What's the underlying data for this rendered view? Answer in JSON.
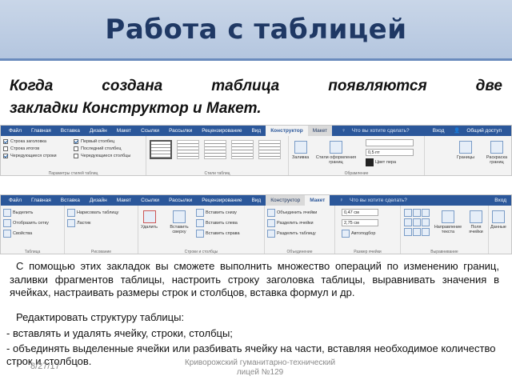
{
  "slide": {
    "title": "Работа с таблицей",
    "subtitle_line1": "Когда создана таблица появляются две",
    "subtitle_line2": "закладки Конструктор и Макет.",
    "paragraph": "С помощью этих закладок вы сможете выполнить множество операций по изменению границ, заливки фрагментов таблицы, настроить строку заголовка таблицы, выравнивать значения в ячейках, настраивать размеры строк и столбцов, вставка формул и др.",
    "edit_heading": "Редактировать структуру таблицы:",
    "bullets": [
      "вставлять и удалять ячейку, строки, столбцы;",
      "объединять выделенные ячейки или разбивать ячейку на части, вставляя необходимое количество строк и столбцов."
    ],
    "date": "8/27/17",
    "school": "Криворожский гуманитарно-технический лицей №129"
  },
  "ribbon1": {
    "tabs": [
      "Файл",
      "Главная",
      "Вставка",
      "Дизайн",
      "Макет",
      "Ссылки",
      "Рассылки",
      "Рецензирование",
      "Вид"
    ],
    "ctx_tab_active": "Конструктор",
    "ctx_tab": "Макет",
    "tell_me": "Что вы хотите сделать?",
    "login": "Вход",
    "share": "Общий доступ",
    "style_options": [
      "Строка заголовка",
      "Строка итогов",
      "Чередующиеся строки",
      "Первый столбец",
      "Последний столбец",
      "Чередующиеся столбцы"
    ],
    "group_style_options": "Параметры стилей таблиц",
    "group_styles": "Стили таблиц",
    "fill_label": "Заливка",
    "border_styles_label": "Стили оформления границ",
    "pen_weight": "0,5 пт",
    "pen_color": "Цвет пера",
    "borders_label": "Границы",
    "painter_label": "Раскраска границ",
    "group_borders": "Обрамление"
  },
  "ribbon2": {
    "tabs": [
      "Файл",
      "Главная",
      "Вставка",
      "Дизайн",
      "Макет",
      "Ссылки",
      "Рассылки",
      "Рецензирование",
      "Вид"
    ],
    "ctx_tab": "Конструктор",
    "ctx_tab_active": "Макет",
    "tell_me": "Что вы хотите сделать?",
    "login": "Вход",
    "select": "Выделить",
    "gridlines": "Отобразить сетку",
    "properties": "Свойства",
    "group_table": "Таблица",
    "draw_table": "Нарисовать таблицу",
    "eraser": "Ластик",
    "group_draw": "Рисование",
    "delete": "Удалить",
    "insert_above": "Вставить сверху",
    "insert_below": "Вставить снизу",
    "insert_left": "Вставить слева",
    "insert_right": "Вставить справа",
    "group_rows": "Строки и столбцы",
    "merge": "Объединить ячейки",
    "split_cells": "Разделить ячейки",
    "split_table": "Разделить таблицу",
    "group_merge": "Объединение",
    "height": "0,47 см",
    "width": "2,75 см",
    "autofit": "Автоподбор",
    "group_size": "Размер ячейки",
    "text_direction": "Направление текста",
    "margins": "Поля ячейки",
    "group_align": "Выравнивание",
    "data": "Данные"
  }
}
